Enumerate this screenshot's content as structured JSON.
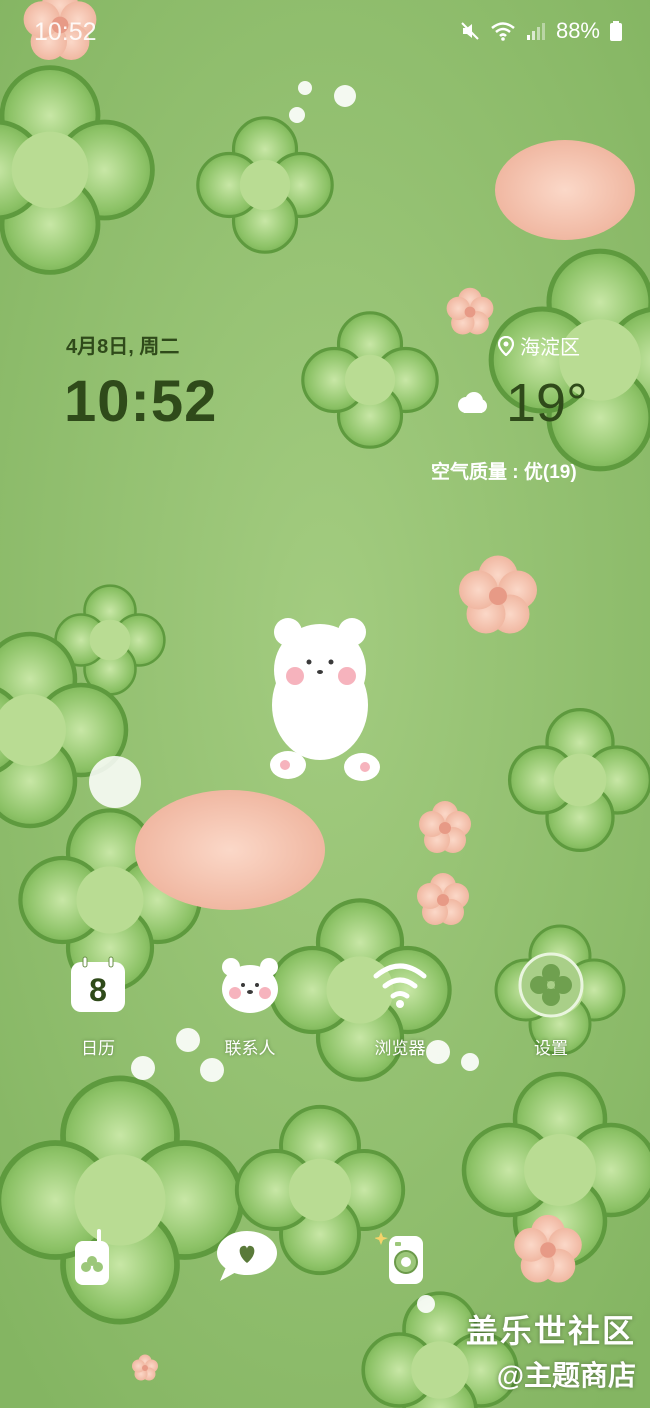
{
  "status_bar": {
    "time": "10:52",
    "battery": "88%"
  },
  "lockscreen": {
    "date": "4月8日, 周二",
    "clock": "10:52"
  },
  "weather": {
    "location": "海淀区",
    "temperature": "19°",
    "air_quality": "空气质量 : 优(19)"
  },
  "apps": [
    {
      "label": "日历",
      "icon": "calendar-icon",
      "badge": "8"
    },
    {
      "label": "联系人",
      "icon": "bear-contacts-icon"
    },
    {
      "label": "浏览器",
      "icon": "wifi-browser-icon"
    },
    {
      "label": "设置",
      "icon": "clover-settings-icon"
    }
  ],
  "dock": [
    {
      "icon": "phone-icon"
    },
    {
      "icon": "message-heart-icon"
    },
    {
      "icon": "camera-icon"
    }
  ],
  "watermark": {
    "line1": "盖乐世社区",
    "line2": "@主题商店"
  },
  "colors": {
    "background": "#8fbe6c",
    "clock_text": "#2f4a1a",
    "flower_pink": "#f2b9a3"
  }
}
